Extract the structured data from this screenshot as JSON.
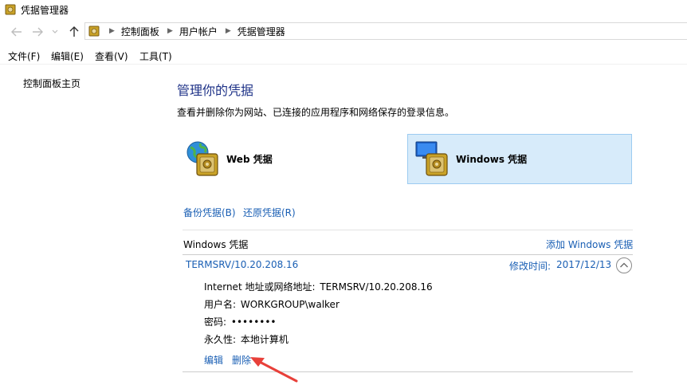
{
  "window": {
    "title": "凭据管理器"
  },
  "address_bar": {
    "breadcrumbs": [
      "控制面板",
      "用户帐户",
      "凭据管理器"
    ]
  },
  "menu": {
    "items": [
      "文件(F)",
      "编辑(E)",
      "查看(V)",
      "工具(T)"
    ]
  },
  "sidebar": {
    "home_link": "控制面板主页"
  },
  "main": {
    "heading": "管理你的凭据",
    "description": "查看并删除你为网站、已连接的应用程序和网络保存的登录信息。",
    "web_credentials_label": "Web 凭据",
    "windows_credentials_label": "Windows 凭据",
    "backup_link": "备份凭据(B)",
    "restore_link": "还原凭据(R)",
    "section_title": "Windows 凭据",
    "add_link": "添加 Windows 凭据",
    "entry": {
      "name": "TERMSRV/10.20.208.16",
      "modified_label": "修改时间:",
      "modified_date": "2017/12/13",
      "internet_label": "Internet 地址或网络地址:",
      "internet_value": "TERMSRV/10.20.208.16",
      "user_label": "用户名:",
      "user_value": "WORKGROUP\\walker",
      "password_label": "密码:",
      "password_value": "••••••••",
      "persistence_label": "永久性:",
      "persistence_value": "本地计算机",
      "edit_link": "编辑",
      "delete_link": "删除"
    }
  },
  "annotation": {
    "arrow_color": "#e8403a"
  },
  "colors": {
    "link": "#1a5fb4",
    "heading": "#1e3287",
    "selected_tile": "#d7ebfa"
  }
}
